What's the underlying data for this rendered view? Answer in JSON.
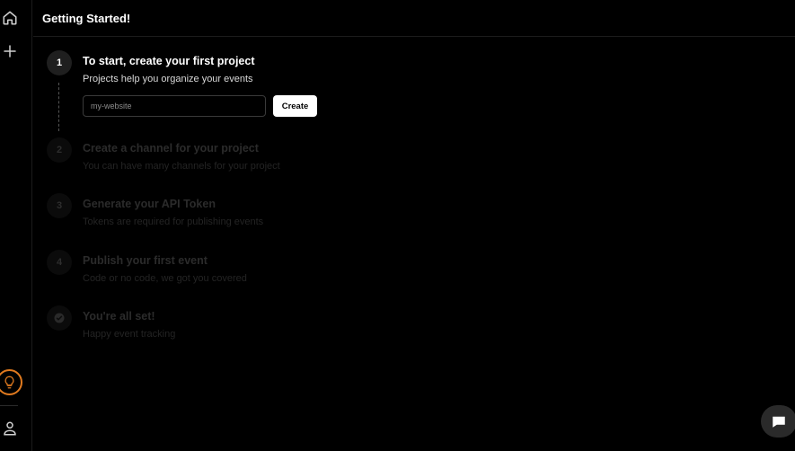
{
  "header": {
    "title": "Getting Started!"
  },
  "sidebar": {
    "items": [
      {
        "icon": "home-icon"
      },
      {
        "icon": "plus-icon"
      },
      {
        "icon": "lightbulb-icon"
      },
      {
        "icon": "user-icon"
      }
    ]
  },
  "steps": [
    {
      "number": "1",
      "title": "To start, create your first project",
      "subtitle": "Projects help you organize your events",
      "active": true
    },
    {
      "number": "2",
      "title": "Create a channel for your project",
      "subtitle": "You can have many channels for your project",
      "active": false
    },
    {
      "number": "3",
      "title": "Generate your API Token",
      "subtitle": "Tokens are required for publishing events",
      "active": false
    },
    {
      "number": "4",
      "title": "Publish your first event",
      "subtitle": "Code or no code, we got you covered",
      "active": false
    },
    {
      "number": "",
      "title": "You're all set!",
      "subtitle": "Happy event tracking",
      "active": false
    }
  ],
  "project_form": {
    "placeholder": "my-website",
    "value": "",
    "create_label": "Create"
  },
  "colors": {
    "background": "#000000",
    "accent": "#e07a1f",
    "button": "#ffffff"
  }
}
